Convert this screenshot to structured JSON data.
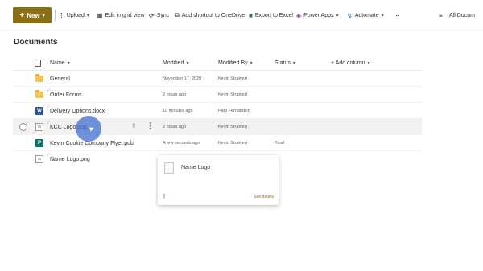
{
  "command_bar": {
    "new_label": "New",
    "upload_label": "Upload",
    "edit_grid_label": "Edit in grid view",
    "sync_label": "Sync",
    "add_shortcut_label": "Add shortcut to OneDrive",
    "export_excel_label": "Export to Excel",
    "power_apps_label": "Power Apps",
    "automate_label": "Automate",
    "more_label": "···",
    "all_documents_label": "All Docum",
    "accent_color": "#8b6f14"
  },
  "page": {
    "title": "Documents"
  },
  "columns": {
    "name": "Name",
    "modified": "Modified",
    "modified_by": "Modified By",
    "status": "Status",
    "add_column": "+ Add column"
  },
  "rows": [
    {
      "name": "General",
      "icon": "folder-icon",
      "modified": "November 17, 2020",
      "modified_by": "Kevin Stratvert",
      "status": ""
    },
    {
      "name": "Order Forms",
      "icon": "folder-icon",
      "modified": "2 hours ago",
      "modified_by": "Kevin Stratvert",
      "status": ""
    },
    {
      "name": "Delivery Options.docx",
      "icon": "word-icon",
      "modified": "10 minutes ago",
      "modified_by": "Patti Fernandez",
      "status": ""
    },
    {
      "name": "KCC Logo.png",
      "icon": "image-icon",
      "modified": "2 hours ago",
      "modified_by": "Kevin Stratvert",
      "status": ""
    },
    {
      "name": "Kevin Cookie Company Flyer.pub",
      "icon": "publisher-icon",
      "modified": "A few seconds ago",
      "modified_by": "Kevin Stratvert",
      "status": "Final"
    },
    {
      "name": "Name Logo.png",
      "icon": "image-icon",
      "modified": "",
      "modified_by": "",
      "status": ""
    }
  ],
  "hover_card": {
    "title": "Name Logo",
    "see_details": "See details"
  }
}
